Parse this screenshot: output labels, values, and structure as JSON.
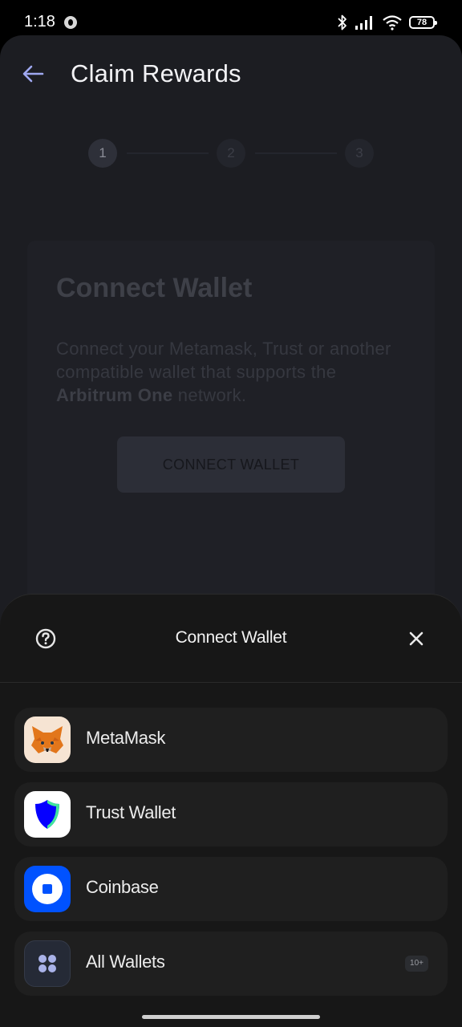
{
  "status_bar": {
    "time": "1:18",
    "battery": "78",
    "icons": [
      "app-notification-icon",
      "bluetooth-icon",
      "cellular-signal-icon",
      "wifi-icon",
      "battery-icon"
    ]
  },
  "header": {
    "title": "Claim Rewards",
    "back_icon": "arrow-left-icon"
  },
  "stepper": {
    "steps": [
      "1",
      "2",
      "3"
    ],
    "active_step": 1
  },
  "card": {
    "title": "Connect Wallet",
    "description_prefix": "Connect your Metamask, Trust or another compatible wallet that supports the ",
    "description_bold": "Arbitrum One",
    "description_suffix": " network.",
    "button_label": "CONNECT WALLET"
  },
  "sheet": {
    "title": "Connect Wallet",
    "help_icon": "help-circle-icon",
    "close_icon": "close-icon",
    "wallets": [
      {
        "label": "MetaMask",
        "icon": "metamask-fox-icon"
      },
      {
        "label": "Trust Wallet",
        "icon": "trust-shield-icon"
      },
      {
        "label": "Coinbase",
        "icon": "coinbase-icon"
      },
      {
        "label": "All Wallets",
        "icon": "grid-dots-icon",
        "badge": "10+"
      }
    ]
  },
  "colors": {
    "sheet_background": "#171717",
    "screen_background": "#1c1d22",
    "trust_blue": "#0500ff",
    "coinbase_blue": "#0052ff",
    "metamask_orange": "#e2761b",
    "all_wallets_dots": "#a9b2e8"
  }
}
